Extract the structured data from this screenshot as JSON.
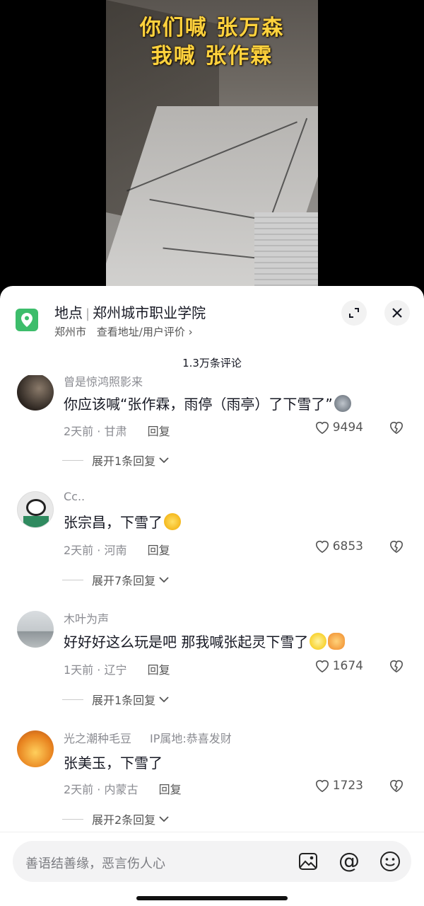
{
  "video": {
    "caption_line1": "你们喊 张万森",
    "caption_line2": "我喊 张作霖"
  },
  "location": {
    "label": "地点",
    "place": "郑州城市职业学院",
    "city": "郑州市",
    "link": "查看地址/用户评价",
    "accent": "#3dbd6b"
  },
  "comments_count": "1.3万条评论",
  "comments": [
    {
      "user": "曾是惊鸿照影来",
      "text": "你应该喊“张作霖，雨停（雨亭）了下雪了”",
      "time": "2天前",
      "region": "甘肃",
      "reply": "回复",
      "likes": "9494",
      "expand": "展开1条回复"
    },
    {
      "user": "Cc..",
      "text": "张宗昌，下雪了",
      "time": "2天前",
      "region": "河南",
      "reply": "回复",
      "likes": "6853",
      "expand": "展开7条回复"
    },
    {
      "user": "木叶为声",
      "text": "好好好这么玩是吧 那我喊张起灵下雪了",
      "time": "1天前",
      "region": "辽宁",
      "reply": "回复",
      "likes": "1674",
      "expand": "展开1条回复"
    },
    {
      "user": "光之潮种毛豆",
      "ip": "IP属地:恭喜发财",
      "text": "张美玉，下雪了",
      "time": "2天前",
      "region": "内蒙古",
      "reply": "回复",
      "likes": "1723",
      "expand": "展开2条回复"
    }
  ],
  "input": {
    "placeholder": "善语结善缘，恶言伤人心"
  }
}
